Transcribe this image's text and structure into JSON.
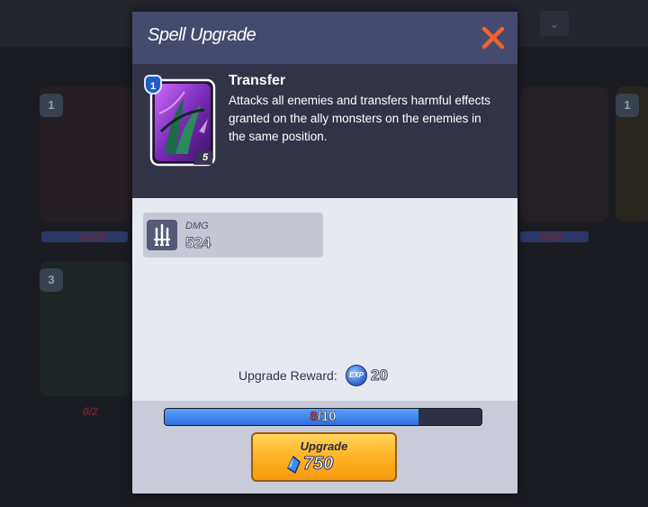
{
  "background": {
    "dropdown_glyph": "⌄",
    "cards": [
      {
        "level": "1",
        "count": "15/20"
      },
      {
        "level": "1",
        "count": "8/10"
      },
      {
        "level": "1",
        "count": ""
      },
      {
        "level": "3",
        "count": "0/2"
      }
    ]
  },
  "dialog": {
    "title": "Spell Upgrade",
    "close_icon": "close-icon",
    "spell": {
      "name": "Transfer",
      "description": "Attacks all enemies and transfers harmful effects granted on the ally monsters on the enemies in the same position.",
      "level": "1",
      "rank": "5"
    },
    "stat": {
      "label": "DMG",
      "value": "524",
      "icon": "swords-icon"
    },
    "reward": {
      "label": "Upgrade Reward:",
      "coin_icon": "exp-coin-icon",
      "coin_text": "EXP",
      "amount": "20"
    },
    "progress": {
      "current": "8",
      "separator": "/",
      "max": "10",
      "fraction": 0.8
    },
    "upgrade_button": {
      "label": "Upgrade",
      "cost": "750",
      "cost_icon": "blue-gem-icon"
    }
  },
  "colors": {
    "header": "#454b6e",
    "close": "#f2622e",
    "panel": "#323346",
    "progress_fill": "#3a80ec",
    "button": "#ffb01e"
  }
}
